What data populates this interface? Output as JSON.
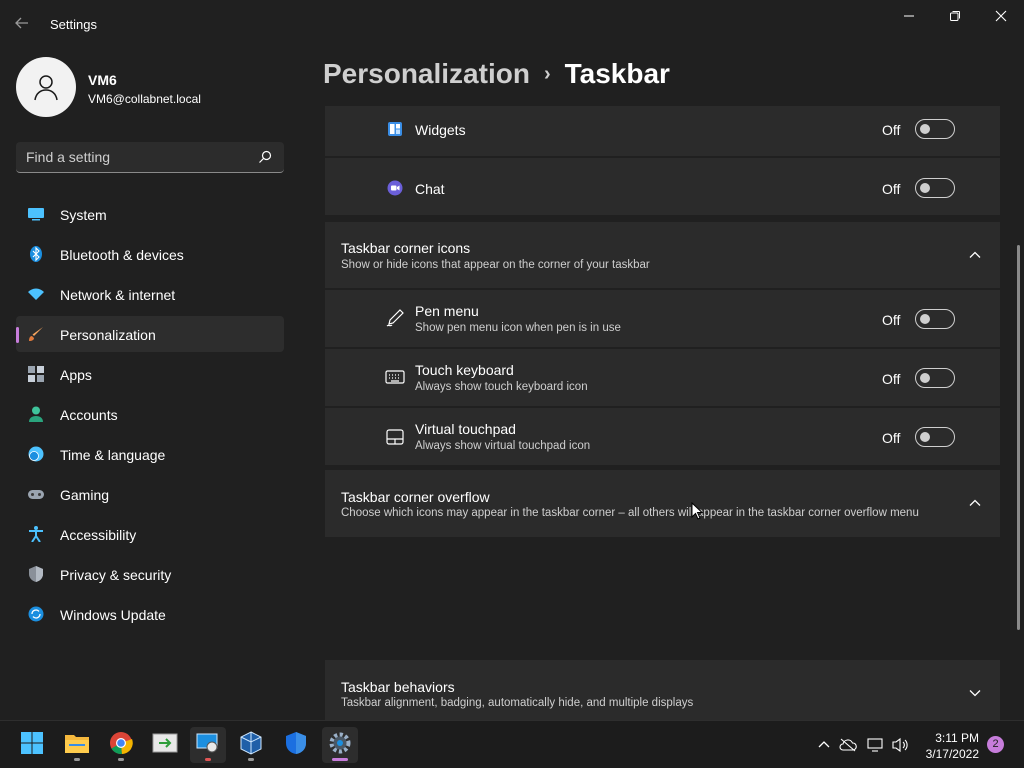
{
  "window": {
    "title": "Settings"
  },
  "user": {
    "name": "VM6",
    "email": "VM6@collabnet.local"
  },
  "search": {
    "placeholder": "Find a setting"
  },
  "nav": {
    "items": [
      {
        "label": "System",
        "icon": "monitor-icon"
      },
      {
        "label": "Bluetooth & devices",
        "icon": "bluetooth-icon"
      },
      {
        "label": "Network & internet",
        "icon": "wifi-icon"
      },
      {
        "label": "Personalization",
        "icon": "brush-icon",
        "active": true
      },
      {
        "label": "Apps",
        "icon": "apps-icon"
      },
      {
        "label": "Accounts",
        "icon": "person-icon"
      },
      {
        "label": "Time & language",
        "icon": "clock-globe-icon"
      },
      {
        "label": "Gaming",
        "icon": "gamepad-icon"
      },
      {
        "label": "Accessibility",
        "icon": "accessibility-icon"
      },
      {
        "label": "Privacy & security",
        "icon": "shield-icon"
      },
      {
        "label": "Windows Update",
        "icon": "update-icon"
      }
    ]
  },
  "header": {
    "parent": "Personalization",
    "separator": "›",
    "current": "Taskbar"
  },
  "taskbar_items": [
    {
      "title": "Widgets",
      "state": "Off",
      "icon": "widgets-icon"
    },
    {
      "title": "Chat",
      "state": "Off",
      "icon": "chat-icon"
    }
  ],
  "corner_icons": {
    "title": "Taskbar corner icons",
    "subtitle": "Show or hide icons that appear on the corner of your taskbar",
    "items": [
      {
        "title": "Pen menu",
        "subtitle": "Show pen menu icon when pen is in use",
        "state": "Off",
        "icon": "pen-icon"
      },
      {
        "title": "Touch keyboard",
        "subtitle": "Always show touch keyboard icon",
        "state": "Off",
        "icon": "keyboard-icon"
      },
      {
        "title": "Virtual touchpad",
        "subtitle": "Always show virtual touchpad icon",
        "state": "Off",
        "icon": "touchpad-icon"
      }
    ]
  },
  "corner_overflow": {
    "title": "Taskbar corner overflow",
    "subtitle": "Choose which icons may appear in the taskbar corner – all others will appear in the taskbar corner overflow menu"
  },
  "behaviors": {
    "title": "Taskbar behaviors",
    "subtitle": "Taskbar alignment, badging, automatically hide, and multiple displays"
  },
  "system_taskbar": {
    "apps": [
      "windows-start-icon",
      "file-explorer-icon",
      "chrome-icon",
      "terminal-icon",
      "remote-desktop-icon",
      "virtualbox-icon",
      "defender-icon",
      "settings-icon"
    ],
    "clock": {
      "time": "3:11 PM",
      "date": "3/17/2022"
    },
    "notifications": "2"
  },
  "colors": {
    "accent": "#c77ddb",
    "background": "#202020",
    "card": "#2b2b2b"
  }
}
